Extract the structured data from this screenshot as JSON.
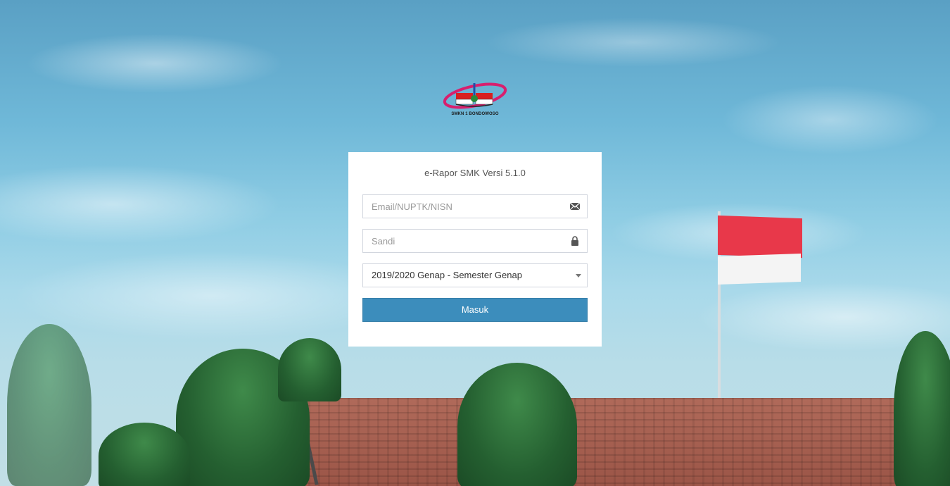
{
  "logo": {
    "caption": "SMKN 1 BONDOWOSO",
    "icon": "school-logo"
  },
  "login": {
    "title": "e-Rapor SMK Versi 5.1.0",
    "email": {
      "placeholder": "Email/NUPTK/NISN",
      "value": "",
      "icon": "envelope-icon"
    },
    "password": {
      "placeholder": "Sandi",
      "value": "",
      "icon": "lock-icon"
    },
    "semester": {
      "selected": "2019/2020 Genap - Semester Genap"
    },
    "submit_label": "Masuk"
  },
  "colors": {
    "primary_button": "#3c8dbc",
    "box_background": "#ffffff",
    "field_border": "#d2d6de"
  }
}
